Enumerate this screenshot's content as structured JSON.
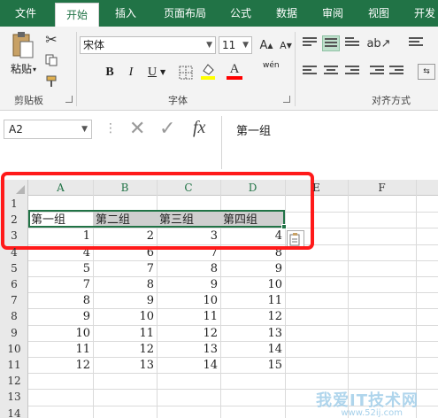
{
  "tabs": [
    {
      "label": "文件",
      "active": false
    },
    {
      "label": "开始",
      "active": true
    },
    {
      "label": "插入",
      "active": false
    },
    {
      "label": "页面布局",
      "active": false
    },
    {
      "label": "公式",
      "active": false
    },
    {
      "label": "数据",
      "active": false
    },
    {
      "label": "审阅",
      "active": false
    },
    {
      "label": "视图",
      "active": false
    },
    {
      "label": "开发",
      "active": false
    }
  ],
  "ribbon": {
    "clipboard": {
      "paste_label": "粘贴",
      "group_label": "剪贴板"
    },
    "font": {
      "font_name": "宋体",
      "font_size": "11",
      "group_label": "字体",
      "bold": "B",
      "italic": "I",
      "underline": "U",
      "phonetic": "wén"
    },
    "alignment": {
      "group_label": "对齐方式"
    },
    "colors": {
      "accent": "#217346",
      "fill": "#ffff00",
      "font_color": "#ff0000"
    }
  },
  "formula_bar": {
    "name_box": "A2",
    "cancel": "✕",
    "confirm": "✓",
    "fx": "fx",
    "content": "第一组"
  },
  "sheet": {
    "columns": [
      "A",
      "B",
      "C",
      "D",
      "E",
      "F"
    ],
    "rows": [
      "1",
      "2",
      "3",
      "4",
      "5",
      "6",
      "7",
      "8",
      "9",
      "10",
      "11",
      "12",
      "13",
      "14"
    ],
    "header_row": [
      "第一组",
      "第二组",
      "第三组",
      "第四组"
    ],
    "data": [
      [
        1,
        2,
        3,
        4
      ],
      [
        4,
        6,
        7,
        8
      ],
      [
        5,
        7,
        8,
        9
      ],
      [
        7,
        8,
        9,
        10
      ],
      [
        8,
        9,
        10,
        11
      ],
      [
        9,
        10,
        11,
        12
      ],
      [
        10,
        11,
        12,
        13
      ],
      [
        11,
        12,
        13,
        14
      ],
      [
        12,
        13,
        14,
        15
      ]
    ]
  },
  "watermark": {
    "text": "我爱IT技术网",
    "url": "www.52ij.com"
  }
}
